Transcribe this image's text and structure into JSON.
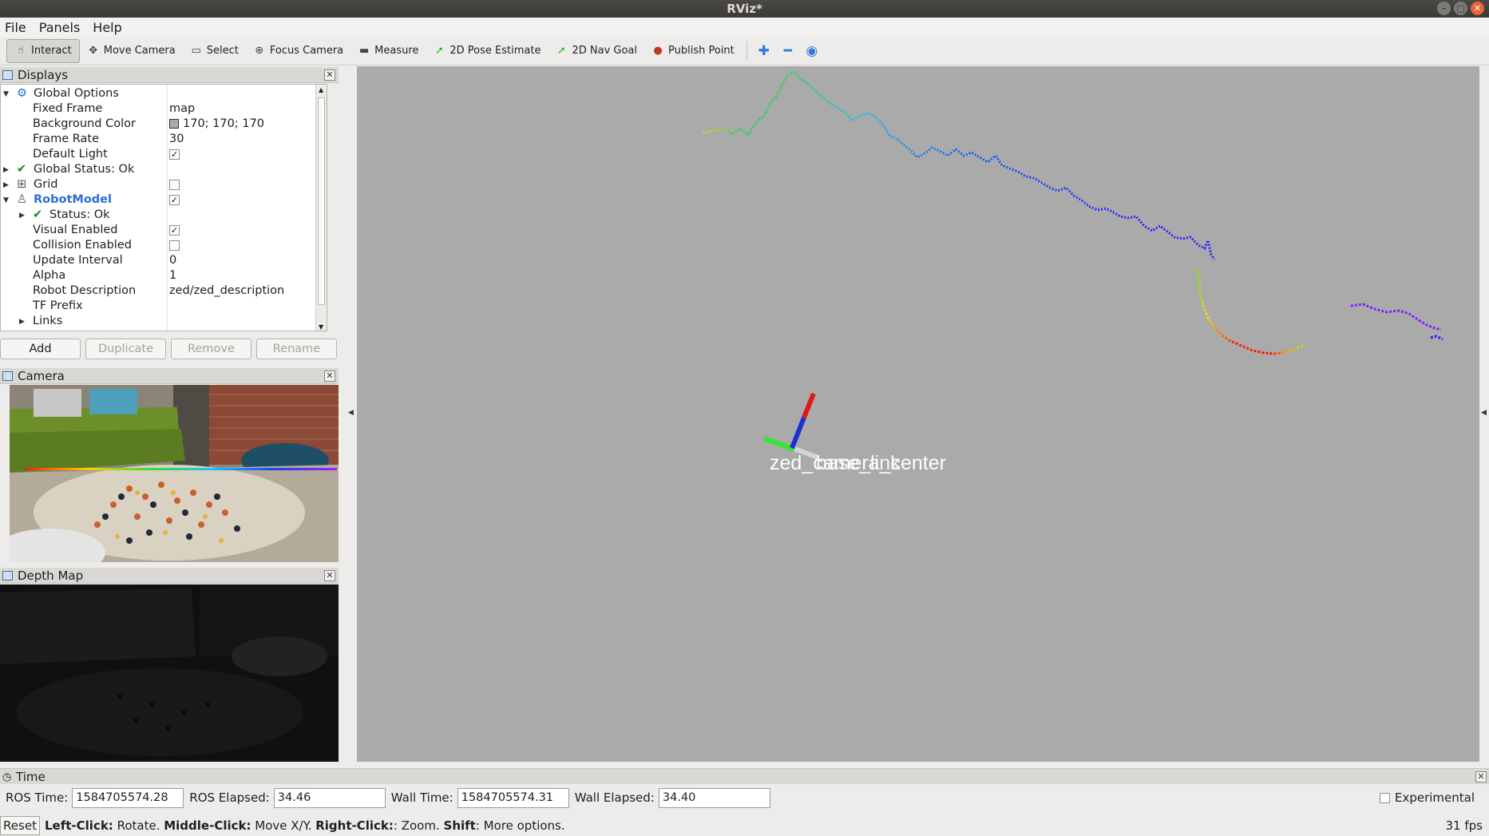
{
  "window": {
    "title": "RViz*"
  },
  "menu": [
    "File",
    "Panels",
    "Help"
  ],
  "toolbar": {
    "tools": [
      {
        "label": "Interact",
        "icon": "hand-icon",
        "glyph": "☝",
        "active": true
      },
      {
        "label": "Move Camera",
        "icon": "move-camera-icon",
        "glyph": "✥"
      },
      {
        "label": "Select",
        "icon": "select-icon",
        "glyph": "▭"
      },
      {
        "label": "Focus Camera",
        "icon": "focus-camera-icon",
        "glyph": "⊕"
      },
      {
        "label": "Measure",
        "icon": "ruler-icon",
        "glyph": "▬"
      },
      {
        "label": "2D Pose Estimate",
        "icon": "pose-arrow-icon",
        "glyph": "➚"
      },
      {
        "label": "2D Nav Goal",
        "icon": "nav-arrow-icon",
        "glyph": "➚"
      },
      {
        "label": "Publish Point",
        "icon": "map-pin-icon",
        "glyph": "●"
      }
    ]
  },
  "displays": {
    "title": "Displays",
    "rows": [
      {
        "label": "Global Options",
        "indent": 0,
        "arrow": "down",
        "icon": "gear"
      },
      {
        "label": "Fixed Frame",
        "value": "map",
        "indent": 2
      },
      {
        "label": "Background Color",
        "value": "170; 170; 170",
        "indent": 2,
        "color": "#aaaaaa"
      },
      {
        "label": "Frame Rate",
        "value": "30",
        "indent": 2
      },
      {
        "label": "Default Light",
        "indent": 2,
        "check": true
      },
      {
        "label": "Global Status: Ok",
        "indent": 0,
        "arrow": "right",
        "icon": "ok"
      },
      {
        "label": "Grid",
        "indent": 0,
        "arrow": "right",
        "icon": "grid",
        "check": false
      },
      {
        "label": "RobotModel",
        "indent": 0,
        "arrow": "down",
        "icon": "robot",
        "check": true,
        "highlight": true
      },
      {
        "label": "Status: Ok",
        "indent": 1,
        "arrow": "right",
        "icon": "ok"
      },
      {
        "label": "Visual Enabled",
        "indent": 2,
        "check": true
      },
      {
        "label": "Collision Enabled",
        "indent": 2,
        "check": false
      },
      {
        "label": "Update Interval",
        "value": "0",
        "indent": 2
      },
      {
        "label": "Alpha",
        "value": "1",
        "indent": 2
      },
      {
        "label": "Robot Description",
        "value": "zed/zed_description",
        "indent": 2
      },
      {
        "label": "TF Prefix",
        "value": "",
        "indent": 2
      },
      {
        "label": "Links",
        "indent": 1,
        "arrow": "right"
      }
    ],
    "buttons": [
      {
        "label": "Add",
        "enabled": true
      },
      {
        "label": "Duplicate",
        "enabled": false
      },
      {
        "label": "Remove",
        "enabled": false
      },
      {
        "label": "Rename",
        "enabled": false
      }
    ]
  },
  "camera_panel": {
    "title": "Camera"
  },
  "depth_panel": {
    "title": "Depth Map"
  },
  "viewport": {
    "background": "#aaaaaa",
    "frame_labels": "zed_camera_center",
    "frame_labels_overlap": "base_link"
  },
  "time": {
    "title": "Time",
    "ros_time_label": "ROS Time:",
    "ros_time": "1584705574.28",
    "ros_elapsed_label": "ROS Elapsed:",
    "ros_elapsed": "34.46",
    "wall_time_label": "Wall Time:",
    "wall_time": "1584705574.31",
    "wall_elapsed_label": "Wall Elapsed:",
    "wall_elapsed": "34.40",
    "experimental_label": "Experimental"
  },
  "status": {
    "reset_label": "Reset",
    "left_click": "Left-Click:",
    "left_click_action": " Rotate. ",
    "middle_click": "Middle-Click:",
    "middle_click_action": " Move X/Y. ",
    "right_click": "Right-Click:",
    "right_click_action": ": Zoom. ",
    "shift": "Shift",
    "shift_action": ": More options.",
    "fps": "31 fps"
  }
}
